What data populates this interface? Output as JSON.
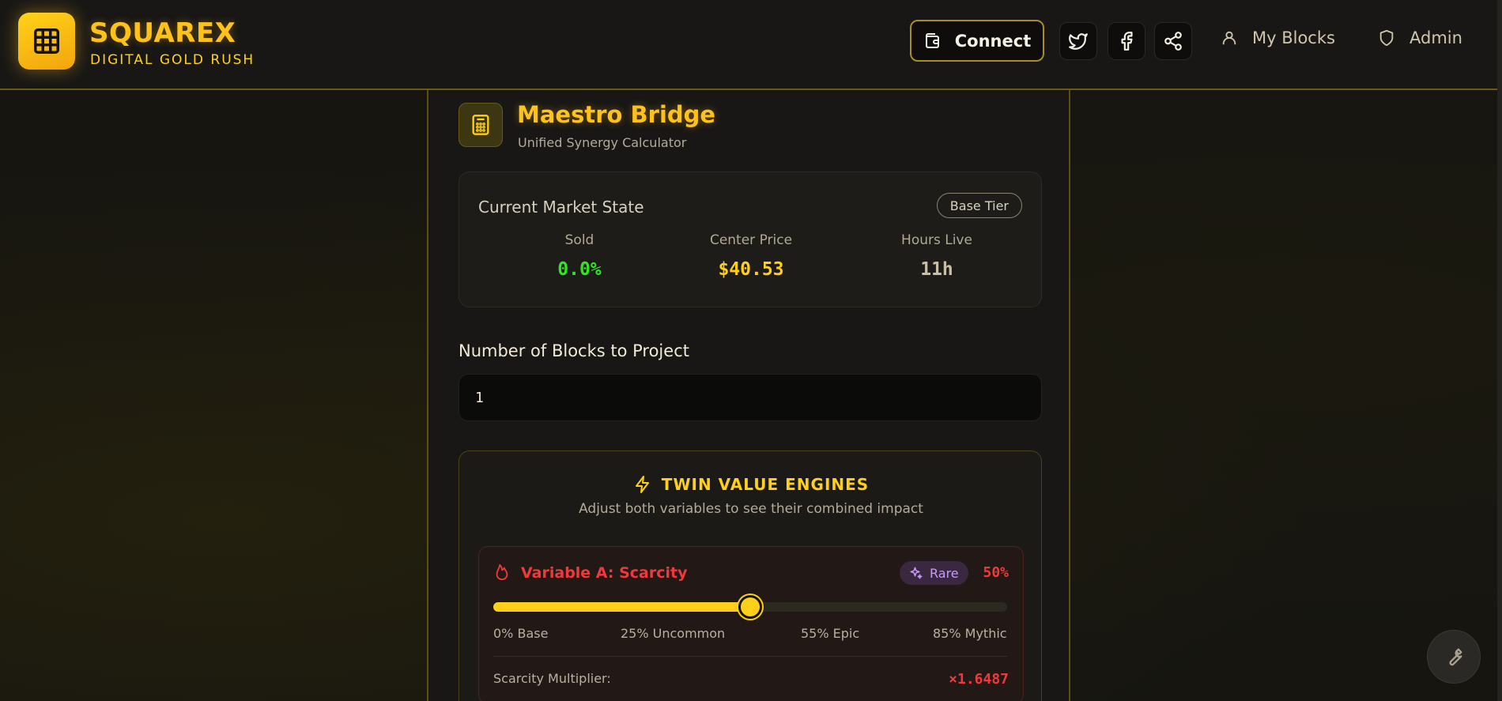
{
  "header": {
    "brand_name": "SQUAREX",
    "brand_tagline": "DIGITAL GOLD RUSH",
    "connect_label": "Connect",
    "nav": [
      {
        "label": "My Blocks",
        "icon": "user-icon"
      },
      {
        "label": "Admin",
        "icon": "shield-icon"
      }
    ],
    "social": [
      "twitter-icon",
      "facebook-icon",
      "share-icon"
    ]
  },
  "panel": {
    "title": "Maestro Bridge",
    "subtitle": "Unified Synergy Calculator"
  },
  "market": {
    "title": "Current Market State",
    "tier_badge": "Base Tier",
    "stats": [
      {
        "label": "Sold",
        "value": "0.0%",
        "color": "#2ee81e"
      },
      {
        "label": "Center Price",
        "value": "$40.53",
        "color": "#ffcf1a"
      },
      {
        "label": "Hours Live",
        "value": "11h",
        "color": "#c9bfa6"
      }
    ]
  },
  "blocks": {
    "label": "Number of Blocks to Project",
    "value": "1"
  },
  "engines": {
    "title": "TWIN VALUE ENGINES",
    "subtitle": "Adjust both variables to see their combined impact"
  },
  "variable_a": {
    "title": "Variable A: Scarcity",
    "rarity_badge": "Rare",
    "percent_text": "50%",
    "slider_fraction": 0.5,
    "ticks": [
      "0% Base",
      "25% Uncommon",
      "55% Epic",
      "85% Mythic"
    ],
    "multiplier_label": "Scarcity Multiplier:",
    "multiplier_value": "×1.6487"
  },
  "colors": {
    "accent": "#ffc21a",
    "danger": "#f0393a",
    "rare": "#c89cf2"
  }
}
